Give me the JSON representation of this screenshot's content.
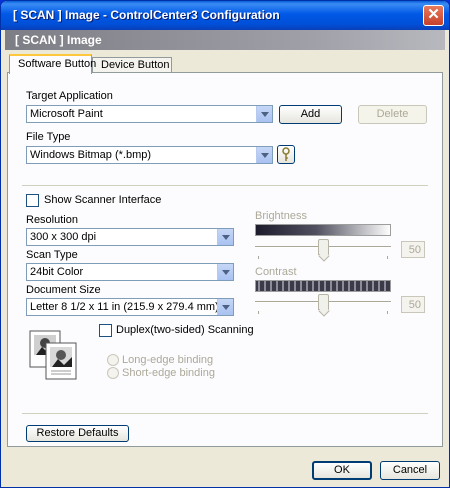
{
  "window": {
    "title": "[ SCAN ]   Image - ControlCenter3 Configuration",
    "close_glyph": "✕"
  },
  "banner": {
    "text": "[ SCAN ]   Image"
  },
  "tabs": [
    {
      "label": "Software Button",
      "active": true
    },
    {
      "label": "Device Button",
      "active": false
    }
  ],
  "target_application": {
    "label": "Target Application",
    "value": "Microsoft Paint",
    "add_label": "Add",
    "delete_label": "Delete"
  },
  "file_type": {
    "label": "File Type",
    "value": "Windows Bitmap (*.bmp)"
  },
  "show_scanner_interface": {
    "label": "Show Scanner Interface",
    "checked": false
  },
  "resolution": {
    "label": "Resolution",
    "value": "300 x 300 dpi"
  },
  "scan_type": {
    "label": "Scan Type",
    "value": "24bit Color"
  },
  "document_size": {
    "label": "Document Size",
    "value": "Letter 8 1/2 x 11 in (215.9 x 279.4 mm)"
  },
  "brightness": {
    "label": "Brightness",
    "value": "50",
    "level": 0.5
  },
  "contrast": {
    "label": "Contrast",
    "value": "50",
    "level": 0.5
  },
  "duplex": {
    "label": "Duplex(two-sided) Scanning",
    "checked": false,
    "long_edge_label": "Long-edge binding",
    "short_edge_label": "Short-edge binding"
  },
  "restore_defaults_label": "Restore Defaults",
  "footer": {
    "ok_label": "OK",
    "cancel_label": "Cancel"
  },
  "colors": {
    "accent": "#0058e6",
    "tab_highlight": "#ffc73c",
    "disabled_text": "#aca899"
  },
  "icons": [
    "close-icon",
    "dropdown-arrow-icon",
    "key-icon",
    "duplex-document-icon"
  ]
}
